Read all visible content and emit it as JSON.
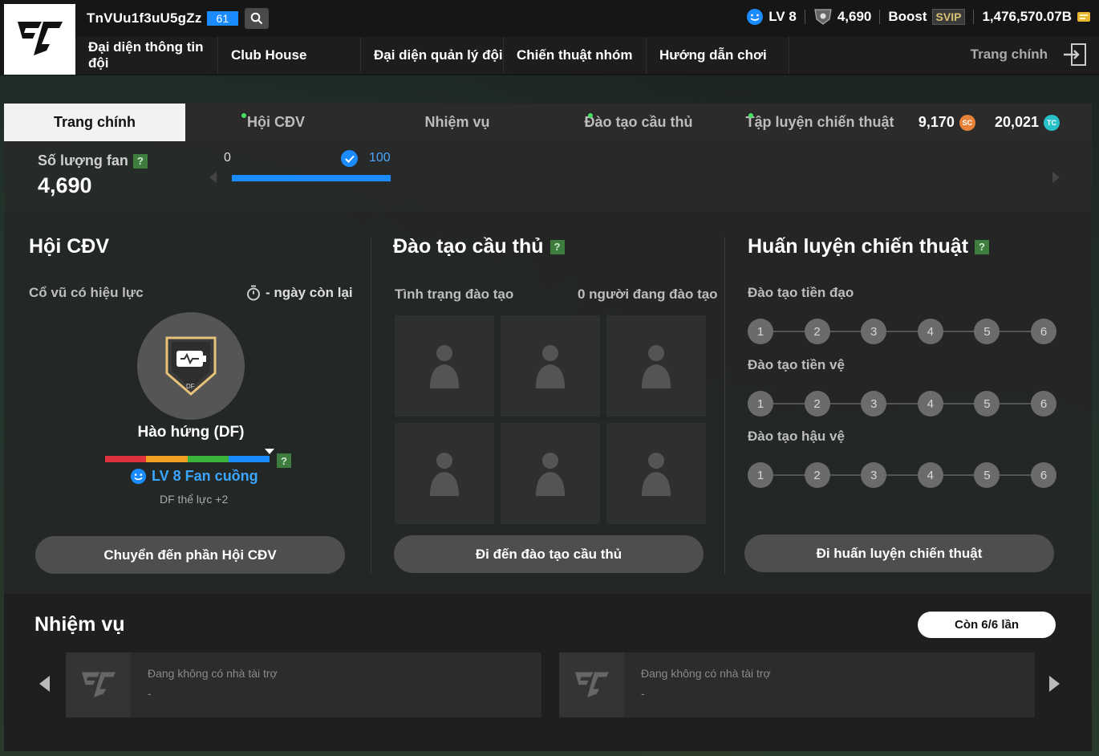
{
  "header": {
    "username": "TnVUu1f3uU5gZz",
    "level_badge": "61",
    "stats": {
      "level": "LV 8",
      "fans": "4,690",
      "boost": "Boost",
      "svip": "SVIP",
      "bp": "1,476,570.07B"
    },
    "nav": [
      "Đại diện thông tin đội",
      "Club House",
      "Đại diện quản lý đội",
      "Chiến thuật nhóm",
      "Hướng dẫn chơi"
    ],
    "home": "Trang chính"
  },
  "tabs": [
    {
      "label": "Trang chính",
      "dot": false
    },
    {
      "label": "Hội CĐV",
      "dot": true
    },
    {
      "label": "Nhiệm vụ",
      "dot": false
    },
    {
      "label": "Đào tạo cầu thủ",
      "dot": true
    },
    {
      "label": "Tập luyện chiến thuật",
      "dot": true
    }
  ],
  "currency": {
    "sc": "9,170",
    "sc_icon": "SC",
    "tc": "20,021",
    "tc_icon": "TC"
  },
  "fan_bar": {
    "label": "Số lượng fan",
    "help": "?",
    "value": "4,690",
    "progress_start": "0",
    "progress_end": "100",
    "progress_fraction": 1.0
  },
  "fan_club": {
    "title": "Hội CĐV",
    "effect_label": "Cổ vũ có hiệu lực",
    "days_left": "- ngày còn lại",
    "badge_tag": "DF",
    "badge_name": "Hào hứng (DF)",
    "help": "?",
    "fan_level": "LV 8 Fan cuồng",
    "bonus": "DF thể lực +2",
    "button": "Chuyển đến phần Hội CĐV"
  },
  "training": {
    "title": "Đào tạo cầu thủ",
    "help": "?",
    "status_label": "Tình trạng đào tạo",
    "status_value": "0 người đang đào tạo",
    "button": "Đi đến đào tạo cầu thủ"
  },
  "tactics": {
    "title": "Huấn luyện chiến thuật",
    "help": "?",
    "rows": [
      {
        "label": "Đào tạo tiền đạo",
        "nodes": [
          "1",
          "2",
          "3",
          "4",
          "5",
          "6"
        ]
      },
      {
        "label": "Đào tạo tiền vệ",
        "nodes": [
          "1",
          "2",
          "3",
          "4",
          "5",
          "6"
        ]
      },
      {
        "label": "Đào tạo hậu vệ",
        "nodes": [
          "1",
          "2",
          "3",
          "4",
          "5",
          "6"
        ]
      }
    ],
    "button": "Đi huấn luyện chiến thuật"
  },
  "missions": {
    "title": "Nhiệm vụ",
    "remaining": "Còn 6/6 lần",
    "cards": [
      {
        "text": "Đang không có nhà tài trợ",
        "sub": "-"
      },
      {
        "text": "Đang không có nhà tài trợ",
        "sub": "-"
      }
    ]
  },
  "colors": {
    "accent": "#1a8cff",
    "active_dot": "#4ee05a",
    "rainbow": [
      "#e0323c",
      "#f0a020",
      "#3cb43c",
      "#1a8cff"
    ]
  }
}
